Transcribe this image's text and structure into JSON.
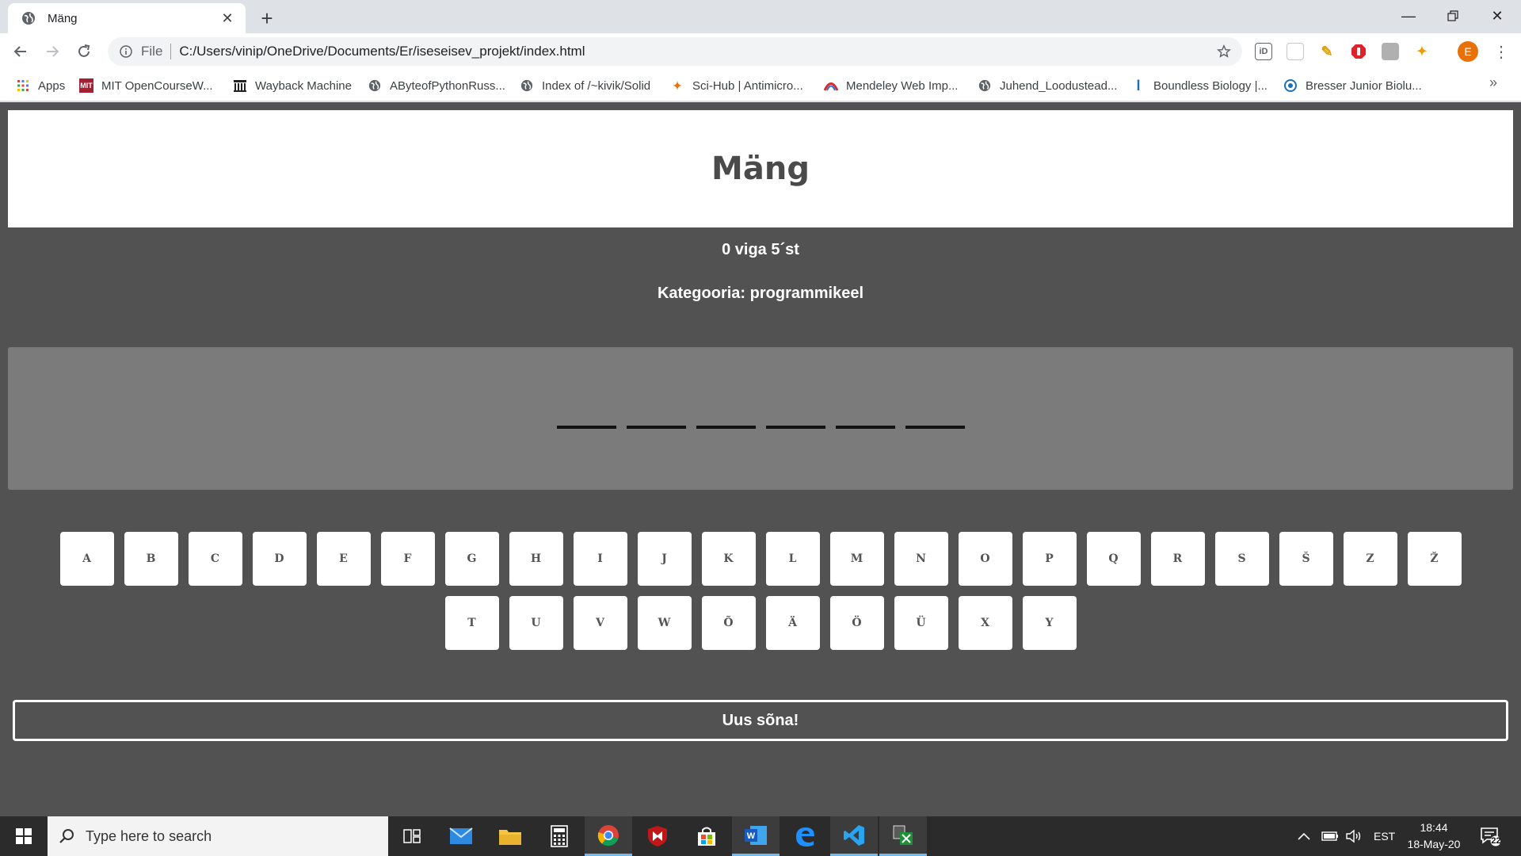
{
  "browser": {
    "tab_title": "Mäng",
    "url_scheme": "File",
    "url": "C:/Users/vinip/OneDrive/Documents/Er/iseseisev_projekt/index.html",
    "avatar_letter": "E",
    "bookmarks": [
      {
        "label": "Apps",
        "icon": "apps-grid-icon"
      },
      {
        "label": "MIT OpenCourseW...",
        "icon": "mit-logo-icon"
      },
      {
        "label": "Wayback Machine",
        "icon": "archive-icon"
      },
      {
        "label": "AByteofPythonRuss...",
        "icon": "globe-icon"
      },
      {
        "label": "Index of /~kivik/Solid",
        "icon": "globe-icon"
      },
      {
        "label": "Sci-Hub | Antimicro...",
        "icon": "raven-icon"
      },
      {
        "label": "Mendeley Web Imp...",
        "icon": "mendeley-icon"
      },
      {
        "label": "Juhend_Loodustead...",
        "icon": "globe-icon"
      },
      {
        "label": "Boundless Biology |...",
        "icon": "boundless-icon"
      },
      {
        "label": "Bresser Junior Biolu...",
        "icon": "bresser-icon"
      }
    ],
    "bookmarks_more": "»"
  },
  "game": {
    "title": "Mäng",
    "mistakes": "0 viga 5´st",
    "category": "Kategooria: programmikeel",
    "word_length": 6,
    "keys_row1": [
      "A",
      "B",
      "C",
      "D",
      "E",
      "F",
      "G",
      "H",
      "I",
      "J",
      "K",
      "L",
      "M",
      "N",
      "O",
      "P",
      "Q",
      "R",
      "S",
      "Š",
      "Z",
      "Ž"
    ],
    "keys_row2": [
      "T",
      "U",
      "V",
      "W",
      "Õ",
      "Ä",
      "Ö",
      "Ü",
      "X",
      "Y"
    ],
    "new_word": "Uus sõna!"
  },
  "taskbar": {
    "search_placeholder": "Type here to search",
    "language": "EST",
    "time": "18:44",
    "date": "18-May-20",
    "notification_count": "22",
    "pinned": [
      "task-view-icon",
      "mail-icon",
      "file-explorer-icon",
      "calculator-icon",
      "chrome-icon",
      "mcafee-icon",
      "store-icon",
      "word-icon",
      "edge-icon",
      "vscode-icon",
      "snipping-icon"
    ]
  },
  "colors": {
    "page_bg": "#525252",
    "word_panel": "#7b7b7b",
    "header_bg": "#ffffff"
  }
}
